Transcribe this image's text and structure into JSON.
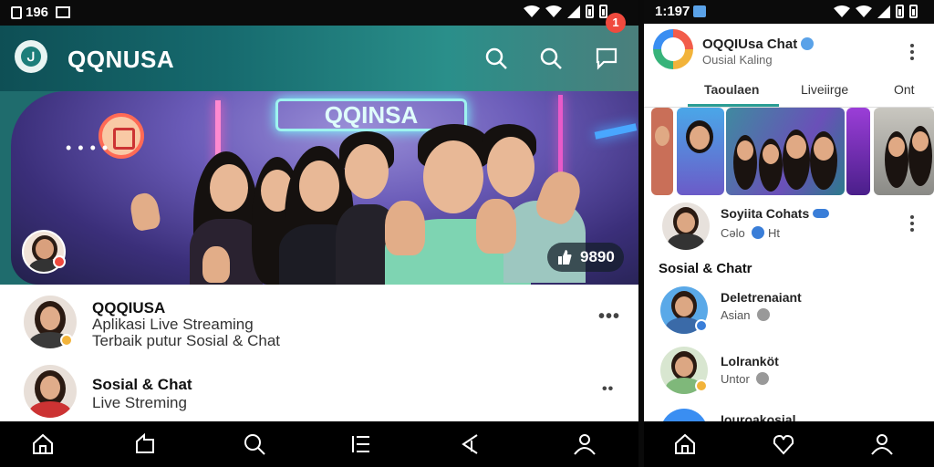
{
  "left_screen": {
    "status_time": "196",
    "app_title": "QQNUSA",
    "chat_badge_count": "1",
    "hero": {
      "neon_sign": "QQINSA",
      "viewer_count": "9890"
    },
    "feed": [
      {
        "title": "QQQIUSA",
        "line1": "Aplikasi Live Streaming",
        "line2": "Terbaik putur Sosial & Chat"
      },
      {
        "title": "Sosial & Chat",
        "line1": "Live Streming",
        "line2": ""
      }
    ]
  },
  "right_screen": {
    "status_time": "1:197",
    "header": {
      "title": "OQQIUsa Chat",
      "subtitle": "Ousial Kaling"
    },
    "tabs": [
      "Taoulaen",
      "Liveiirge",
      "Ont"
    ],
    "live_item": {
      "name": "Soyiita Cohats",
      "meta_label": "Cəlo",
      "meta_value": "Ht"
    },
    "section_title": "Sosial & Chatr",
    "contacts": [
      {
        "name": "Deletrenaiant",
        "meta": "Asian"
      },
      {
        "name": "Lolranköt",
        "meta": "Untor"
      },
      {
        "name": "Iouroakosial",
        "meta": ""
      }
    ]
  },
  "colors": {
    "teal_appbar": "#166a6e",
    "accent": "#2a9d94",
    "badge_red": "#f04a3e",
    "verified_blue": "#5aa2e8"
  }
}
